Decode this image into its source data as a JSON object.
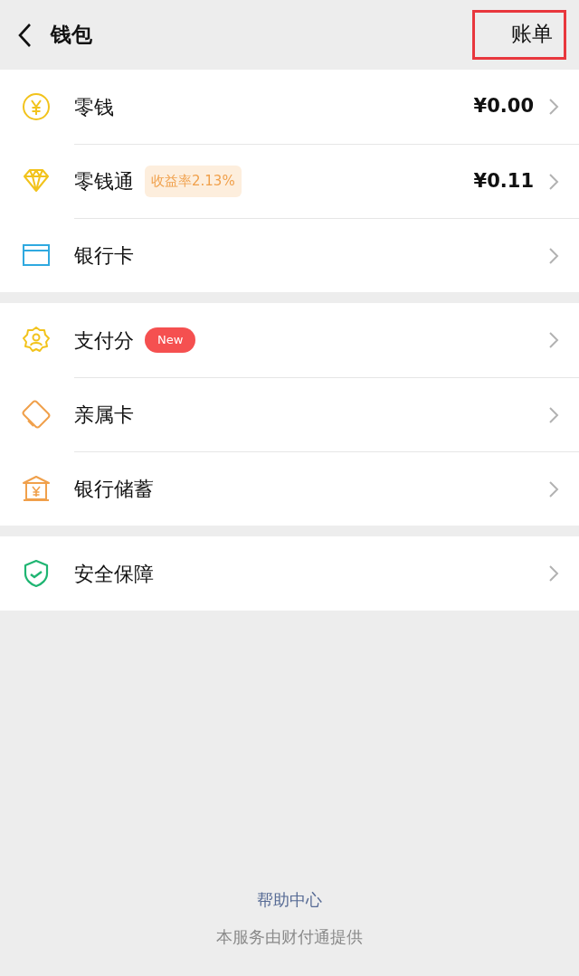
{
  "header": {
    "title": "钱包",
    "action": {
      "label": "账单",
      "highlighted": true
    }
  },
  "groups": [
    {
      "items": [
        {
          "kind": "coin",
          "label": "零钱",
          "value": "¥0.00"
        },
        {
          "kind": "diamond",
          "label": "零钱通",
          "tag": {
            "kind": "yield",
            "text": "收益率2.13%"
          },
          "value": "¥0.11"
        },
        {
          "kind": "card",
          "label": "银行卡"
        }
      ]
    },
    {
      "items": [
        {
          "kind": "badge",
          "label": "支付分",
          "tag": {
            "kind": "new",
            "text": "New"
          }
        },
        {
          "kind": "cards",
          "label": "亲属卡"
        },
        {
          "kind": "bank",
          "label": "银行储蓄"
        }
      ]
    },
    {
      "items": [
        {
          "kind": "shield",
          "label": "安全保障"
        }
      ]
    }
  ],
  "footer": {
    "link": "帮助中心",
    "note": "本服务由财付通提供"
  }
}
